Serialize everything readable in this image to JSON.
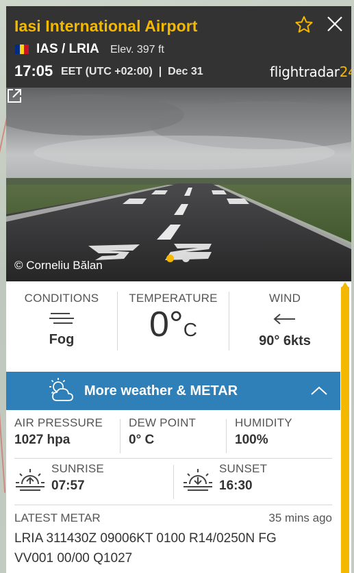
{
  "header": {
    "title": "Iasi International Airport",
    "codes": "IAS / LRIA",
    "elevation": "Elev. 397 ft",
    "time": "17:05",
    "timezone": "EET (UTC +02:00)  |  Dec 31",
    "brand_text": "flightradar",
    "brand_num": "24",
    "flag_colors": [
      "#002b7f",
      "#fcd116",
      "#ce1126"
    ]
  },
  "photo": {
    "credit": "© Corneliu Bălan",
    "runway_number": "32",
    "dots": 2,
    "active_dot": 0
  },
  "conditions": {
    "conditions_label": "CONDITIONS",
    "conditions_value": "Fog",
    "temperature_label": "TEMPERATURE",
    "temperature_value": "0°",
    "temperature_unit": "C",
    "wind_label": "WIND",
    "wind_value": "90° 6kts"
  },
  "weather_bar": {
    "label": "More weather & METAR"
  },
  "details": {
    "air_pressure_label": "AIR PRESSURE",
    "air_pressure_value": "1027 hpa",
    "dew_point_label": "DEW POINT",
    "dew_point_value": "0° C",
    "humidity_label": "HUMIDITY",
    "humidity_value": "100%",
    "sunrise_label": "SUNRISE",
    "sunrise_value": "07:57",
    "sunset_label": "SUNSET",
    "sunset_value": "16:30"
  },
  "metar": {
    "label": "LATEST METAR",
    "ago": "35 mins ago",
    "line1": "LRIA 311430Z 09006KT 0100 R14/0250N FG",
    "line2": "VV001 00/00 Q1027"
  },
  "colors": {
    "accent": "#f5b800",
    "header_bg": "#333333",
    "bar_blue": "#2f7fb8"
  }
}
